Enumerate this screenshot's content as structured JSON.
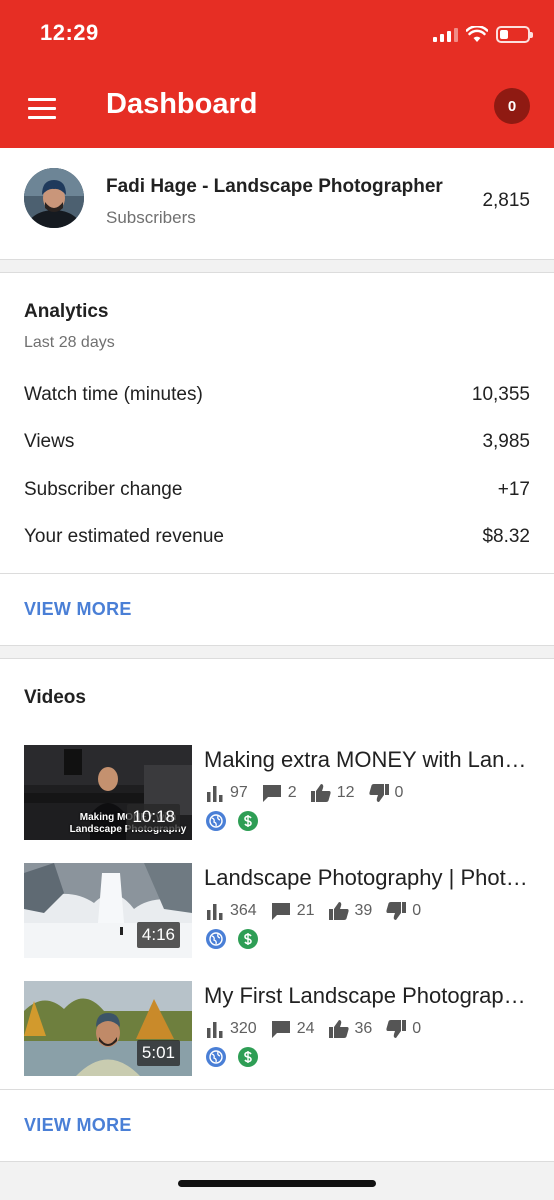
{
  "status_bar": {
    "time": "12:29"
  },
  "header": {
    "title": "Dashboard",
    "notification_count": "0"
  },
  "channel": {
    "name": "Fadi Hage - Landscape Photographer",
    "subscribers_label": "Subscribers",
    "subscribers_count": "2,815"
  },
  "analytics": {
    "title": "Analytics",
    "period": "Last 28 days",
    "metrics": [
      {
        "label": "Watch time (minutes)",
        "value": "10,355"
      },
      {
        "label": "Views",
        "value": "3,985"
      },
      {
        "label": "Subscriber change",
        "value": "+17"
      },
      {
        "label": "Your estimated revenue",
        "value": "$8.32"
      }
    ],
    "view_more": "VIEW MORE"
  },
  "videos": {
    "title": "Videos",
    "items": [
      {
        "title": "Making extra MONEY with Landscape Photography",
        "duration": "10:18",
        "thumb_caption": "Making MONEY with Landscape Photography",
        "views": "97",
        "comments": "2",
        "likes": "12",
        "dislikes": "0"
      },
      {
        "title": "Landscape Photography | Photographing a Frozen Waterfall",
        "duration": "4:16",
        "views": "364",
        "comments": "21",
        "likes": "39",
        "dislikes": "0"
      },
      {
        "title": "My First Landscape Photography Video",
        "duration": "5:01",
        "views": "320",
        "comments": "24",
        "likes": "36",
        "dislikes": "0"
      }
    ],
    "view_more": "VIEW MORE"
  },
  "icons": {
    "views": "bar-chart-icon",
    "comments": "comment-icon",
    "likes": "thumb-up-icon",
    "dislikes": "thumb-down-icon",
    "visibility": "globe-icon",
    "monetization": "dollar-icon"
  },
  "colors": {
    "brand": "#e62e24",
    "link": "#4a7fd6",
    "visibility_badge": "#4a7fd6",
    "monetization_badge": "#2e9e55"
  }
}
